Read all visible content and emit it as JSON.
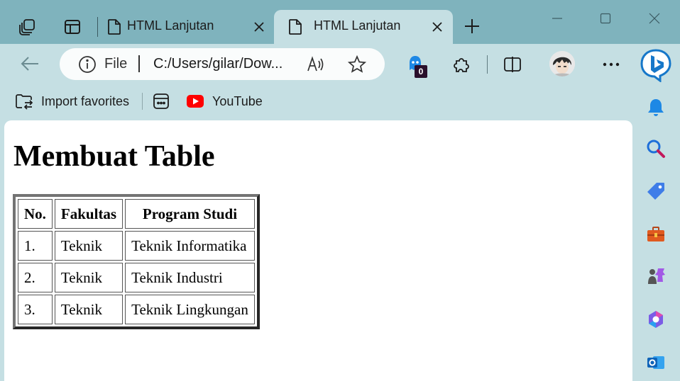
{
  "tabs": [
    {
      "title": "HTML Lanjutan",
      "active": false
    },
    {
      "title": "HTML Lanjutan",
      "active": true
    }
  ],
  "address_bar": {
    "scheme_label": "File",
    "url": "C:/Users/gilar/Dow..."
  },
  "extensions": {
    "ghost_badge": "0"
  },
  "favorites": [
    {
      "label": "Import favorites",
      "icon": "import-favorites-icon"
    },
    {
      "label": "",
      "icon": "apps-folder-icon"
    },
    {
      "label": "YouTube",
      "icon": "youtube-icon"
    }
  ],
  "page": {
    "heading": "Membuat Table",
    "table": {
      "headers": [
        "No.",
        "Fakultas",
        "Program Studi"
      ],
      "rows": [
        [
          "1.",
          "Teknik",
          "Teknik Informatika"
        ],
        [
          "2.",
          "Teknik",
          "Teknik Industri"
        ],
        [
          "3.",
          "Teknik",
          "Teknik Lingkungan"
        ]
      ]
    }
  },
  "sidebar_icons": [
    "bell-icon",
    "search-icon",
    "shopping-tag-icon",
    "tools-icon",
    "games-icon",
    "microsoft-365-icon",
    "outlook-icon"
  ],
  "colors": {
    "tabstrip": "#7fb3bd",
    "toolbar": "#c5dfe3",
    "youtube": "#ff0000",
    "bell": "#1e88e5"
  }
}
